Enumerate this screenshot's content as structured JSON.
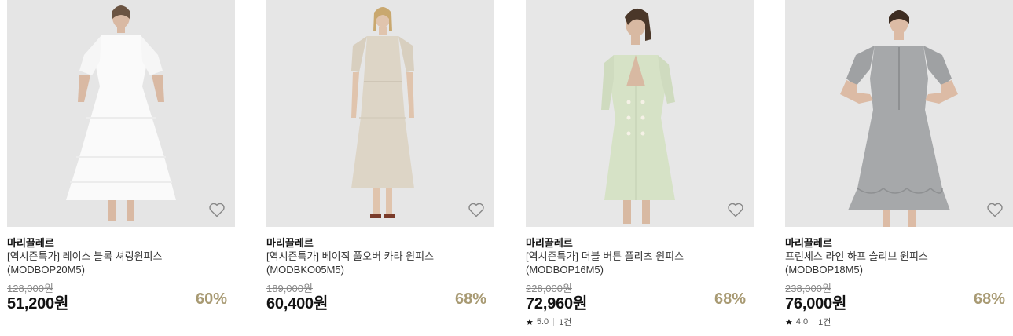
{
  "products": [
    {
      "brand": "마리끌레르",
      "title": "[역시즌특가] 레이스 블록 셔링원피스 (MODBOP20M5)",
      "original_price": "128,000원",
      "price": "51,200원",
      "discount": "60%",
      "image_bg": "#e5e5e5",
      "dress_color": "#fafafa",
      "icon": "heart-outline-icon"
    },
    {
      "brand": "마리끌레르",
      "title": "[역시즌특가] 베이직 풀오버 카라 원피스 (MODBKO05M5)",
      "original_price": "189,000원",
      "price": "60,400원",
      "discount": "68%",
      "image_bg": "#e6e6e6",
      "dress_color": "#ddd5c6",
      "icon": "heart-outline-icon"
    },
    {
      "brand": "마리끌레르",
      "title": "[역시즌특가] 더블 버튼 플리츠 원피스 (MODBOP16M5)",
      "original_price": "228,000원",
      "price": "72,960원",
      "discount": "68%",
      "rating": "5.0",
      "review_count": "1건",
      "image_bg": "#e7e7e7",
      "dress_color": "#d6e2c6",
      "icon": "heart-outline-icon"
    },
    {
      "brand": "마리끌레르",
      "title": "프린세스 라인 하프 슬리브 원피스 (MODBOP18M5)",
      "original_price": "238,000원",
      "price": "76,000원",
      "discount": "68%",
      "rating": "4.0",
      "review_count": "1건",
      "image_bg": "#e6e6e6",
      "dress_color": "#a6a8aa",
      "icon": "heart-outline-icon"
    }
  ],
  "colors": {
    "discount": "#a89a73",
    "strike_price": "#888888",
    "brand_text": "#111111"
  }
}
